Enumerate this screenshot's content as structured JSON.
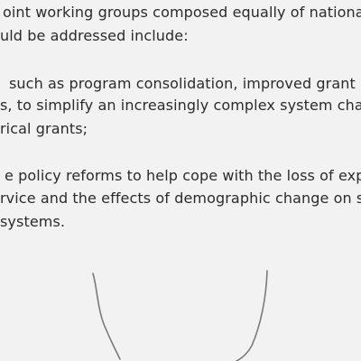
{
  "document": {
    "lines": [
      "oint working groups composed equally of nationa",
      "uld be addressed include:",
      "such as program consolidation, improved grant m",
      "s, to simplify an increasingly complex system char",
      "rical grants;",
      "e policy reforms to help cope with the loss of exp",
      "rvice and the effects of demographic change on se",
      "systems."
    ]
  },
  "scribble": {
    "stroke_color": "#7a7a7a"
  }
}
